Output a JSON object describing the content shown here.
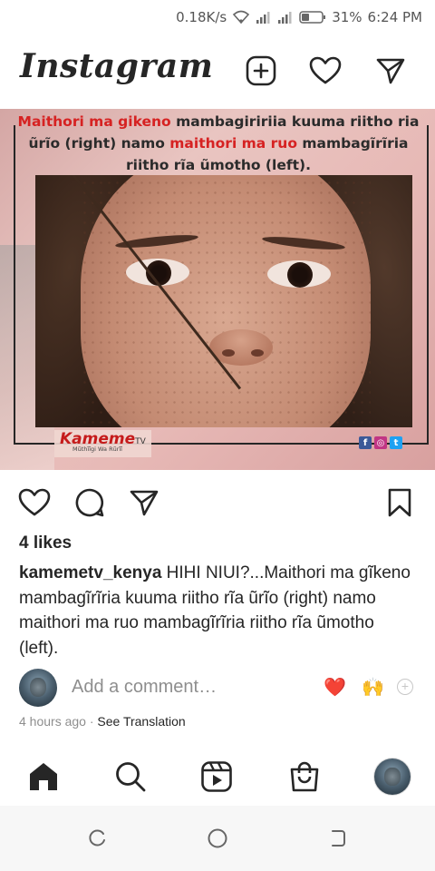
{
  "status_bar": {
    "speed": "0.18K/s",
    "battery": "31%",
    "time": "6:24 PM"
  },
  "header": {
    "logo": "Instagram",
    "icons": [
      "new-post-icon",
      "heart-icon",
      "direct-message-icon"
    ]
  },
  "post": {
    "image_text": {
      "part1_red": "Maithori ma gikeno",
      "part2": " mambagiririia kuuma riitho ria ũrĩo (right) namo ",
      "part3_red": "maithori ma ruo",
      "part4": " mambagĩrĩria riitho rĩa ũmotho (left)."
    },
    "brand": {
      "name": "Kameme",
      "suffix": "TV",
      "tagline": "Mũthĩĩgi Wa Rũrĩĩ"
    },
    "socials": [
      "f",
      "◎",
      "t"
    ],
    "likes": "4 likes",
    "username": "kamemetv_kenya",
    "caption": "HIHI NIUI?...Maithori ma gĩkeno mambagĩrĩria kuuma riitho rĩa ũrĩo (right) namo maithori ma ruo mambagĩrĩria riitho rĩa ũmotho (left).",
    "comment_placeholder": "Add a comment…",
    "quick_reactions": [
      "❤️",
      "🙌"
    ],
    "time_ago": "4 hours ago",
    "separator": " · ",
    "see_translation": "See Translation"
  },
  "bottom_nav": [
    "home-icon",
    "search-icon",
    "reels-icon",
    "shop-icon",
    "profile-avatar"
  ],
  "colors": {
    "accent_red": "#d62222",
    "text": "#262626",
    "muted": "#8e8e8e"
  }
}
